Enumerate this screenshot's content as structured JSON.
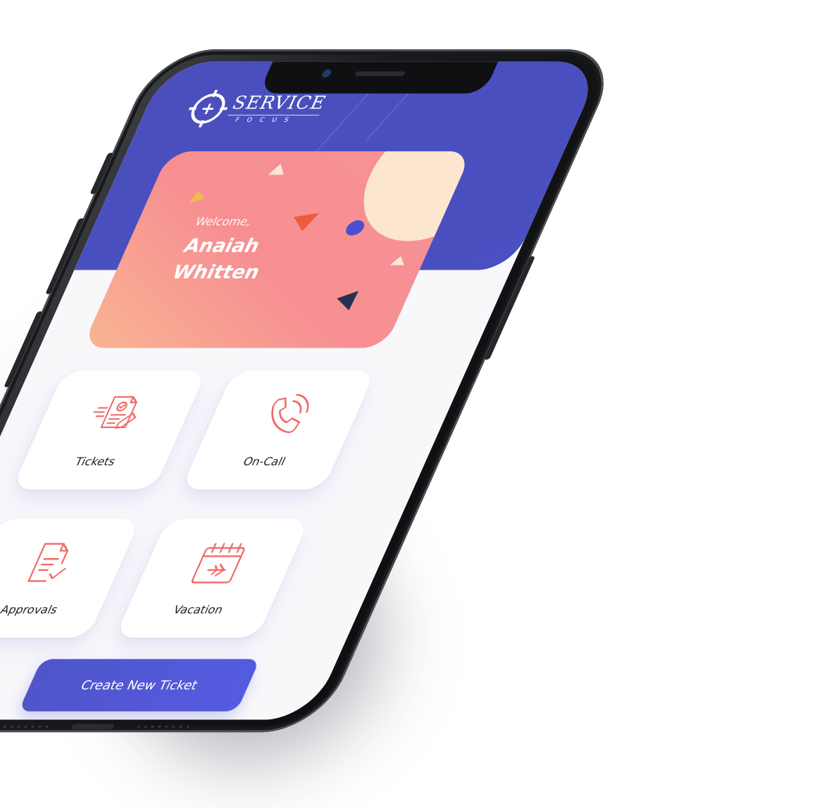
{
  "app": {
    "brand": {
      "name": "SERVICE",
      "tagline": "FOCUS"
    },
    "welcome": {
      "label": "Welcome,",
      "user_name": "Anaiah Whitten"
    },
    "menu_tiles": [
      {
        "label": "Tickets",
        "icon": "ticket-document-icon"
      },
      {
        "label": "On-Call",
        "icon": "phone-call-icon"
      },
      {
        "label": "Approvals",
        "icon": "approval-document-icon"
      },
      {
        "label": "Vacation",
        "icon": "calendar-plane-icon"
      }
    ],
    "primary_action": {
      "label": "Create New Ticket"
    }
  },
  "colors": {
    "header_bg": "#4b4fbd",
    "card_gradient_start": "#f8b592",
    "card_gradient_end": "#f69296",
    "icon_stroke": "#f06a67",
    "button_bg": "#5157d6",
    "tile_label": "#1f1f28"
  }
}
